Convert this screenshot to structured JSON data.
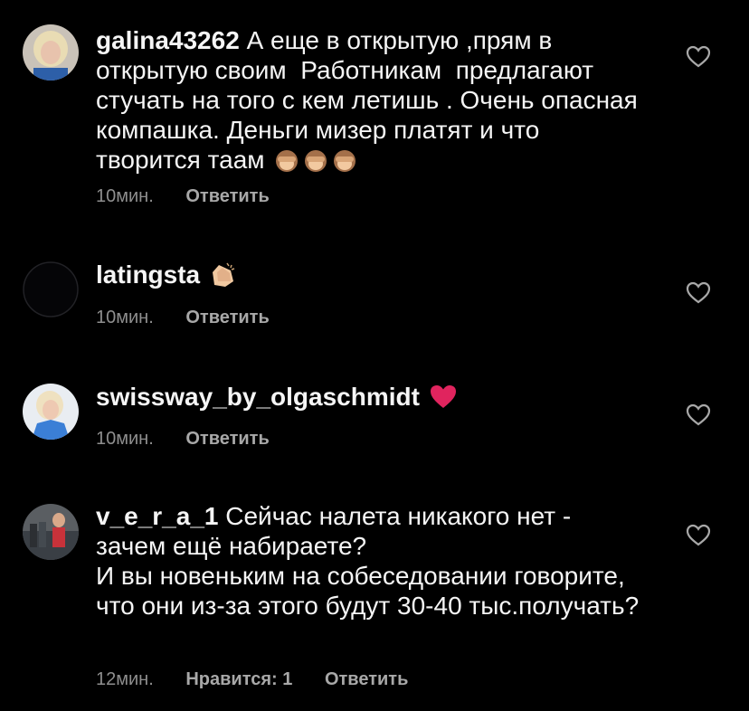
{
  "comments": [
    {
      "username": "galina43262",
      "text": "А еще в открытую ,прям в открытую своим  Работникам  предлагают стучать на того с кем летишь . Очень опасная компашка. Деньги мизер платят и что творится таам",
      "emoji": [
        "see-no-evil-monkey",
        "see-no-evil-monkey",
        "see-no-evil-monkey"
      ],
      "time": "10мин.",
      "reply_label": "Ответить"
    },
    {
      "username": "latingsta",
      "text": "",
      "emoji": [
        "clapping-hands"
      ],
      "time": "10мин.",
      "reply_label": "Ответить"
    },
    {
      "username": "swissway_by_olgaschmidt",
      "text": "",
      "emoji": [
        "red-heart"
      ],
      "time": "10мин.",
      "reply_label": "Ответить"
    },
    {
      "username": "v_e_r_a_1",
      "text": "Сейчас налета никакого нет - зачем ещё набираете?\nИ вы новеньким на собеседовании говорите, что они из-за этого будут 30-40 тыс.получать?",
      "emoji": [],
      "time": "12мин.",
      "likes_label": "Нравится: 1",
      "reply_label": "Ответить"
    }
  ],
  "colors": {
    "background": "#000000",
    "text": "#f5f5f5",
    "meta": "#8e8e8e",
    "heart_emoji": "#e0245e"
  }
}
